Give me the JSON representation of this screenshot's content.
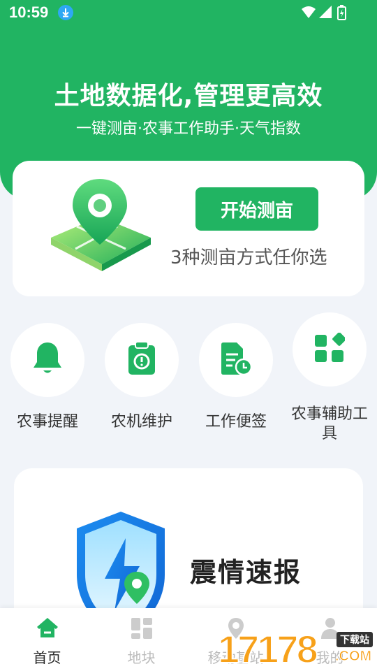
{
  "status_bar": {
    "time": "10:59",
    "icons": [
      "download-icon",
      "wifi-icon",
      "signal-icon",
      "battery-charging-icon"
    ]
  },
  "hero": {
    "title": "土地数据化,管理更高效",
    "subtitle": "一键测亩·农事工作助手·天气指数"
  },
  "measure_card": {
    "button_label": "开始测亩",
    "description": "3种测亩方式任你选"
  },
  "quick_actions": [
    {
      "label": "农事提醒",
      "icon": "bell-icon"
    },
    {
      "label": "农机维护",
      "icon": "clipboard-timer-icon"
    },
    {
      "label": "工作便签",
      "icon": "note-clock-icon"
    },
    {
      "label": "农事辅助工具",
      "icon": "apps-grid-icon"
    }
  ],
  "quake_card": {
    "title": "震情速报",
    "icon": "shield-lightning-icon"
  },
  "bottom_nav": [
    {
      "label": "首页",
      "icon": "home-icon",
      "active": true
    },
    {
      "label": "地块",
      "icon": "plots-grid-icon",
      "active": false
    },
    {
      "label": "移动基站",
      "icon": "location-pin-icon",
      "active": false
    },
    {
      "label": "我的",
      "icon": "person-icon",
      "active": false
    }
  ],
  "watermark": {
    "number": "17178",
    "badge": "下载站",
    "suffix": ".COM"
  },
  "colors": {
    "primary": "#21B462",
    "background": "#F1F4F9",
    "card": "#FFFFFF",
    "watermark": "#F7A11A"
  }
}
